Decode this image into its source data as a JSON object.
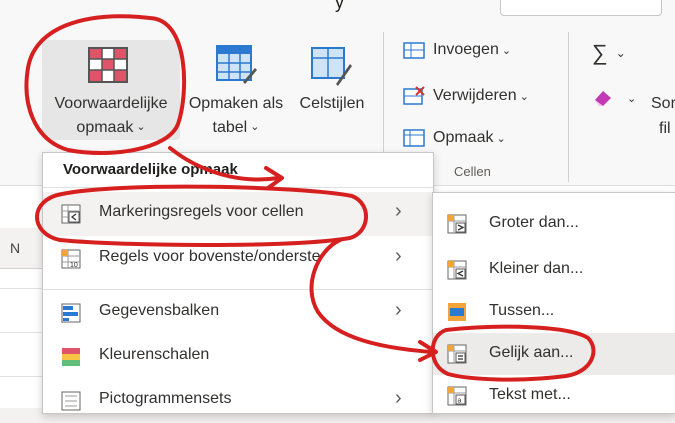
{
  "ribbon": {
    "title_fragment": "y",
    "conditional_formatting": {
      "line1": "Voorwaardelijke",
      "line2": "opmaak"
    },
    "format_as_table": {
      "line1": "Opmaken als",
      "line2": "tabel"
    },
    "cell_styles": {
      "line1": "Celstijlen"
    },
    "cells_group": {
      "insert": "Invoegen",
      "delete": "Verwijderen",
      "format": "Opmaak",
      "label": "Cellen"
    },
    "editing": {
      "sum_symbol": "∑",
      "sort_partial_1": "Sor",
      "sort_partial_2": "fil"
    }
  },
  "sheet": {
    "column_letter": "N"
  },
  "menu": {
    "title": "Voorwaardelijke opmaak",
    "items": [
      {
        "label": "Markeringsregels voor cellen",
        "icon": "highlight-cells-icon",
        "has_submenu": true
      },
      {
        "label": "Regels voor bovenste/onderste",
        "icon": "top-bottom-icon",
        "has_submenu": true
      },
      {
        "label": "Gegevensbalken",
        "icon": "data-bars-icon",
        "has_submenu": true
      },
      {
        "label": "Kleurenschalen",
        "icon": "color-scales-icon",
        "has_submenu": true
      },
      {
        "label": "Pictogrammensets",
        "icon": "icon-sets-icon",
        "has_submenu": true
      }
    ]
  },
  "submenu": {
    "items": [
      {
        "label": "Groter dan...",
        "icon": "greater-than-icon"
      },
      {
        "label": "Kleiner dan...",
        "icon": "less-than-icon"
      },
      {
        "label": "Tussen...",
        "icon": "between-icon"
      },
      {
        "label": "Gelijk aan...",
        "icon": "equal-to-icon"
      },
      {
        "label": "Tekst met...",
        "icon": "text-contains-icon"
      }
    ]
  },
  "colors": {
    "annotation_red": "#d62020",
    "accent_blue": "#2b79d0",
    "accent_red": "#e0546a"
  }
}
